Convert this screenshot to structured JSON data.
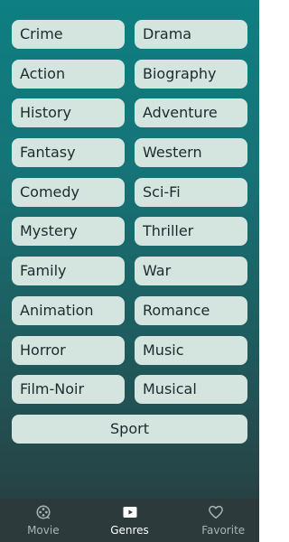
{
  "genres": [
    {
      "label": "Crime"
    },
    {
      "label": "Drama"
    },
    {
      "label": "Action"
    },
    {
      "label": "Biography"
    },
    {
      "label": "History"
    },
    {
      "label": "Adventure"
    },
    {
      "label": "Fantasy"
    },
    {
      "label": "Western"
    },
    {
      "label": "Comedy"
    },
    {
      "label": "Sci-Fi"
    },
    {
      "label": "Mystery"
    },
    {
      "label": "Thriller"
    },
    {
      "label": "Family"
    },
    {
      "label": "War"
    },
    {
      "label": "Animation"
    },
    {
      "label": "Romance"
    },
    {
      "label": "Horror"
    },
    {
      "label": "Music"
    },
    {
      "label": "Film-Noir"
    },
    {
      "label": "Musical"
    },
    {
      "label": "Sport"
    }
  ],
  "bottom_nav": {
    "items": [
      {
        "label": "Movie",
        "icon": "film-reel-icon",
        "active": false
      },
      {
        "label": "Genres",
        "icon": "play-icon",
        "active": true
      },
      {
        "label": "Favorite",
        "icon": "heart-icon",
        "active": false
      }
    ]
  },
  "colors": {
    "background_top": "#0e7f82",
    "background_bottom": "#2a3a3c",
    "button_bg": "#d4e5e0",
    "button_text": "#1c2b2c",
    "nav_bg": "#2d3a3c",
    "nav_active": "#ffffff",
    "nav_inactive": "#a9b4b4"
  }
}
